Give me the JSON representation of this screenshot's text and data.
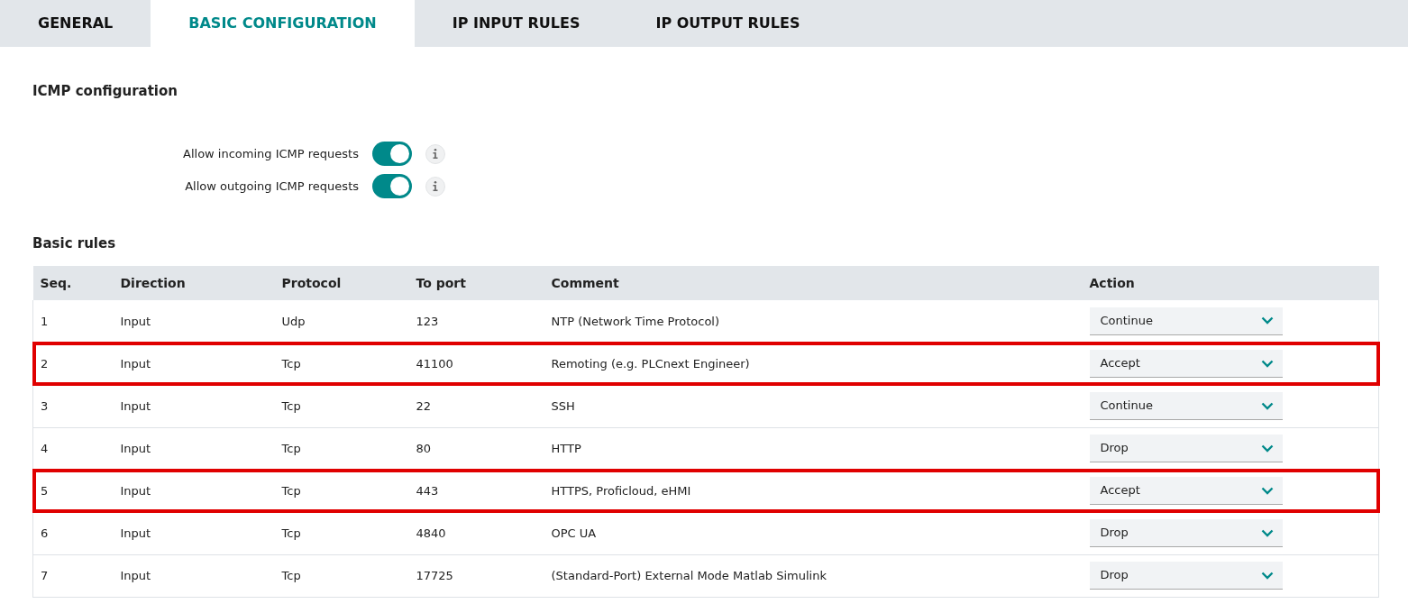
{
  "tabs": [
    {
      "label": "GENERAL",
      "selected": false
    },
    {
      "label": "BASIC CONFIGURATION",
      "selected": true
    },
    {
      "label": "IP INPUT RULES",
      "selected": false
    },
    {
      "label": "IP OUTPUT RULES",
      "selected": false
    }
  ],
  "icmp": {
    "title": "ICMP configuration",
    "settings": [
      {
        "label": "Allow incoming ICMP requests",
        "on": true
      },
      {
        "label": "Allow outgoing ICMP requests",
        "on": true
      }
    ]
  },
  "basic_rules": {
    "title": "Basic rules",
    "columns": [
      "Seq.",
      "Direction",
      "Protocol",
      "To port",
      "Comment",
      "Action"
    ],
    "rows": [
      {
        "seq": "1",
        "direction": "Input",
        "protocol": "Udp",
        "port": "123",
        "comment": "NTP (Network Time Protocol)",
        "action": "Continue",
        "highlighted": false
      },
      {
        "seq": "2",
        "direction": "Input",
        "protocol": "Tcp",
        "port": "41100",
        "comment": "Remoting (e.g. PLCnext Engineer)",
        "action": "Accept",
        "highlighted": true
      },
      {
        "seq": "3",
        "direction": "Input",
        "protocol": "Tcp",
        "port": "22",
        "comment": "SSH",
        "action": "Continue",
        "highlighted": false
      },
      {
        "seq": "4",
        "direction": "Input",
        "protocol": "Tcp",
        "port": "80",
        "comment": "HTTP",
        "action": "Drop",
        "highlighted": false
      },
      {
        "seq": "5",
        "direction": "Input",
        "protocol": "Tcp",
        "port": "443",
        "comment": "HTTPS, Proficloud, eHMI",
        "action": "Accept",
        "highlighted": true
      },
      {
        "seq": "6",
        "direction": "Input",
        "protocol": "Tcp",
        "port": "4840",
        "comment": "OPC UA",
        "action": "Drop",
        "highlighted": false
      },
      {
        "seq": "7",
        "direction": "Input",
        "protocol": "Tcp",
        "port": "17725",
        "comment": "(Standard-Port) External Mode Matlab Simulink",
        "action": "Drop",
        "highlighted": false
      }
    ]
  }
}
